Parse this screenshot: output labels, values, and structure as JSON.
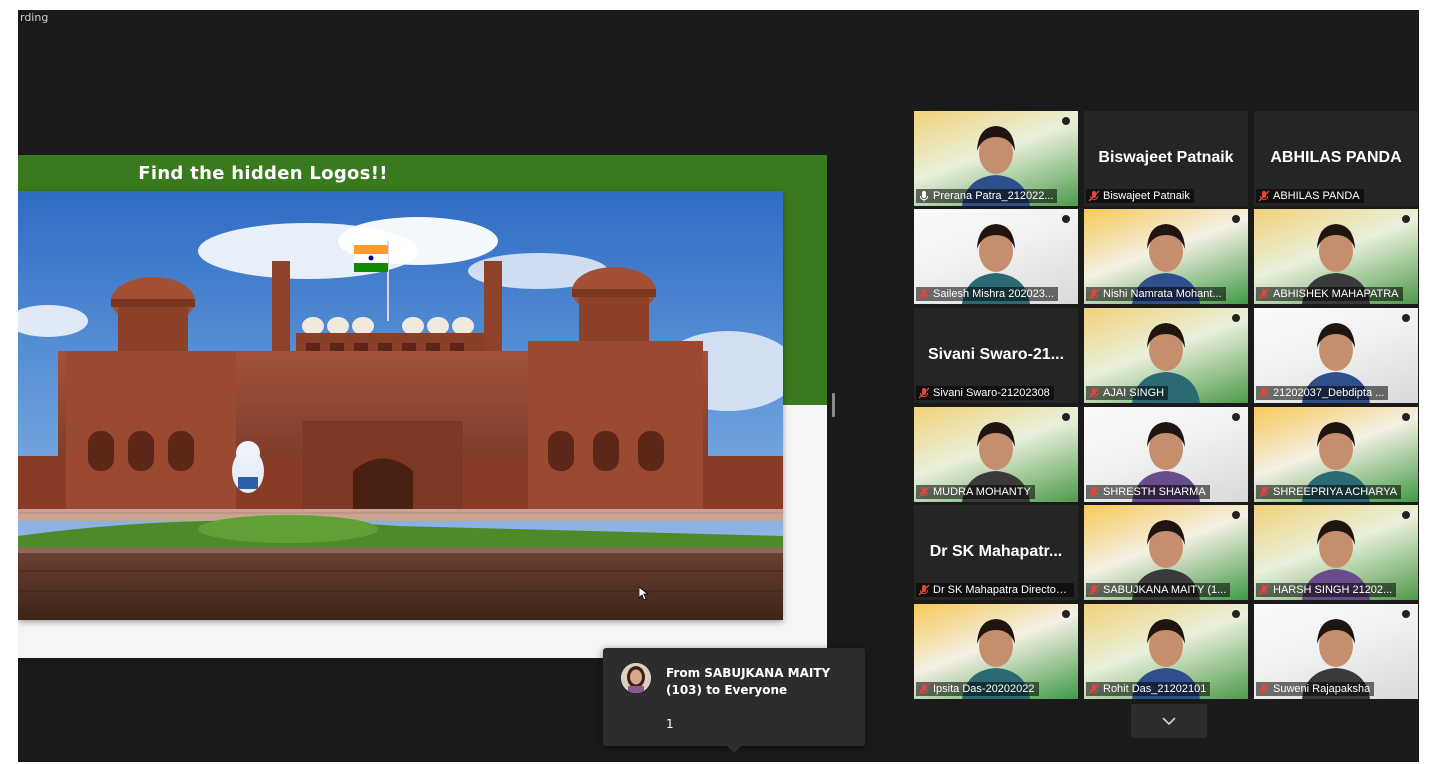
{
  "recording_label": "rding",
  "shared_screen": {
    "slide_title": "Find the hidden Logos!!"
  },
  "gallery": {
    "tiles": [
      {
        "name": "Prerana Patra_212022...",
        "big_name": "",
        "video": true,
        "speaking": true
      },
      {
        "name": "Biswajeet Patnaik",
        "big_name": "Biswajeet Patnaik",
        "video": false,
        "speaking": false
      },
      {
        "name": "ABHILAS PANDA",
        "big_name": "ABHILAS PANDA",
        "video": false,
        "speaking": false
      },
      {
        "name": "Sailesh Mishra 202023...",
        "big_name": "",
        "video": true,
        "speaking": false
      },
      {
        "name": "Nishi Namrata Mohant...",
        "big_name": "",
        "video": true,
        "speaking": false
      },
      {
        "name": "ABHISHEK MAHAPATRA",
        "big_name": "",
        "video": true,
        "speaking": false
      },
      {
        "name": "Sivani Swaro-21202308",
        "big_name": "Sivani Swaro-21...",
        "video": false,
        "speaking": false
      },
      {
        "name": "AJAI SINGH",
        "big_name": "",
        "video": true,
        "speaking": false
      },
      {
        "name": "21202037_Debdipta ...",
        "big_name": "",
        "video": true,
        "speaking": false
      },
      {
        "name": "MUDRA MOHANTY",
        "big_name": "",
        "video": true,
        "speaking": false
      },
      {
        "name": "SHRESTH SHARMA",
        "big_name": "",
        "video": true,
        "speaking": false
      },
      {
        "name": "SHREEPRIYA ACHARYA",
        "big_name": "",
        "video": true,
        "speaking": false
      },
      {
        "name": "Dr SK Mahapatra Director ...",
        "big_name": "Dr SK Mahapatr...",
        "video": false,
        "speaking": false
      },
      {
        "name": "SABUJKANA MAITY (1...",
        "big_name": "",
        "video": true,
        "speaking": false
      },
      {
        "name": "HARSH SINGH 21202...",
        "big_name": "",
        "video": true,
        "speaking": false
      },
      {
        "name": "Ipsita Das-20202022",
        "big_name": "",
        "video": true,
        "speaking": false
      },
      {
        "name": "Rohit Das_21202101",
        "big_name": "",
        "video": true,
        "speaking": false
      },
      {
        "name": "Suweni Rajapaksha",
        "big_name": "",
        "video": true,
        "speaking": false
      }
    ]
  },
  "chat_toast": {
    "from": "From SABUJKANA MAITY (103) to Everyone",
    "message": "1"
  },
  "colors": {
    "window_bg": "#1a1a1a",
    "slide_green": "#3a7a1f",
    "active_speaker": "#d6e33a",
    "muted_mic": "#e0463c"
  },
  "icons": {
    "more_button": "chevron-down-icon",
    "mic": "mic-muted-icon"
  }
}
